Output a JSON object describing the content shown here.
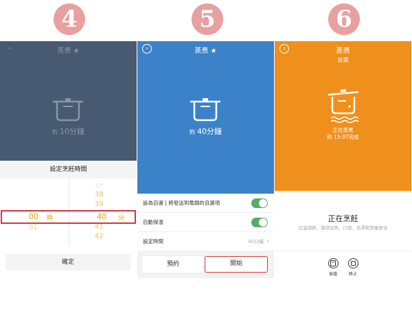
{
  "steps": [
    "4",
    "5",
    "6"
  ],
  "screen4": {
    "title": "蒸煮 ★",
    "time_prefix": "約",
    "time_value": "10分鐘",
    "sheet_title": "設定烹飪時間",
    "picker": {
      "hour_prev": "",
      "hour_selected": "00",
      "hour_unit": "時",
      "hour_next": "01",
      "min_above": [
        "37",
        "38",
        "39"
      ],
      "min_selected": "40",
      "min_unit": "分",
      "min_below": [
        "41",
        "42"
      ]
    },
    "confirm_label": "確定"
  },
  "screen5": {
    "title": "蒸煮 ★",
    "time_prefix": "約",
    "time_value": "40分鐘",
    "rows": [
      {
        "label": "設為自選 | 將發送到電鍋的自選項"
      },
      {
        "label": "自動保溫"
      },
      {
        "label": "設定時間",
        "value": "40分鐘"
      }
    ],
    "reserve_label": "預約",
    "start_label": "開始"
  },
  "screen6": {
    "title": "蒸煮",
    "subtitle": "自選",
    "status_main": "正在蒸煮",
    "status_eta": "約 15:07完成",
    "cooking_title": "正在烹飪",
    "cooking_desc": "控溫調節，循環加熱，口感、色澤和營養更佳",
    "recipe_label": "食譜",
    "stop_label": "終止"
  },
  "colors": {
    "screen4_header": "#485a72",
    "screen5_header": "#3c82c8",
    "screen6_header": "#f0901c",
    "highlight_red": "#d9323c",
    "toggle_green": "#5aaa6a",
    "picker_gold": "#e8a000"
  },
  "icons": {
    "back": "chevron-left-icon",
    "pot": "pot-icon",
    "steam_pot": "steaming-pot-icon",
    "recipe": "recipe-icon",
    "stop": "stop-icon"
  }
}
